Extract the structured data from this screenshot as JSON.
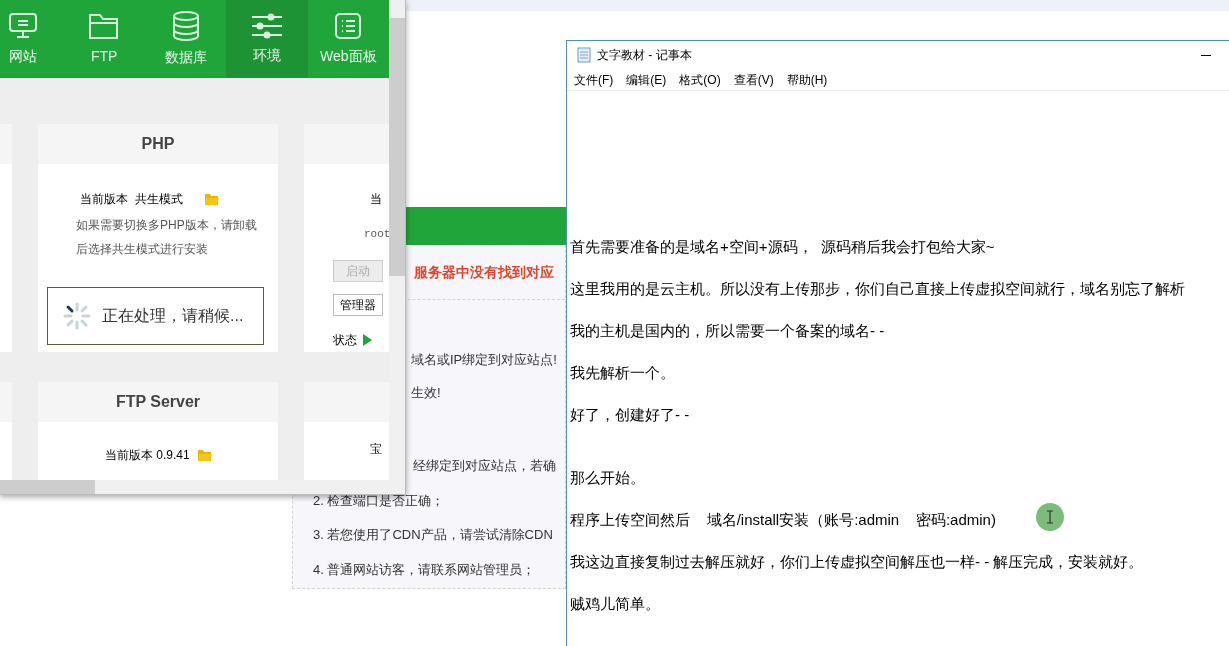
{
  "panel": {
    "nav": [
      {
        "label": "网站",
        "selected": false
      },
      {
        "label": "FTP",
        "selected": false
      },
      {
        "label": "数据库",
        "selected": false
      },
      {
        "label": "环境",
        "selected": true
      },
      {
        "label": "Web面板",
        "selected": false
      }
    ],
    "php_card": {
      "title": "PHP",
      "version": "当前版本  共生模式",
      "note_lines": [
        "如果需要切换多PHP版本，请卸载",
        "后选择共生模式进行安装"
      ]
    },
    "loading": {
      "text": "正在处理，请稍候..."
    },
    "side_card": {
      "line_1": "当",
      "line_2": "root",
      "start_button": {
        "label": "启动",
        "disabled": true
      },
      "manager_button": {
        "label": "管理器",
        "disabled": false
      },
      "status_label": "状态"
    },
    "ftp_card": {
      "title": "FTP Server",
      "version": "当前版本 0.9.41"
    },
    "side_card_2": {
      "line_1": "宝"
    }
  },
  "background_page": {
    "error_title": "服务器中没有找到对应",
    "lines": [
      "域名或IP绑定到对应站点!",
      "生效!"
    ],
    "steps": [
      "经绑定到对应站点，若确",
      "2. 检查端口是否正确；",
      "3. 若您使用了CDN产品，请尝试清除CDN",
      "4. 普通网站访客，请联系网站管理员；"
    ]
  },
  "notepad": {
    "title": "文字教材 - 记事本",
    "menu": [
      "文件(F)",
      "编辑(E)",
      "格式(O)",
      "查看(V)",
      "帮助(H)"
    ],
    "sections": [
      {
        "lines": [
          "首先需要准备的是域名+空间+源码，  源码稍后我会打包给大家~",
          "这里我用的是云主机。所以没有上传那步，你们自己直接上传虚拟空间就行，域名别忘了解析",
          "我的主机是国内的，所以需要一个备案的域名- -",
          "我先解析一个。",
          "好了，创建好了- -"
        ]
      },
      {
        "lines": [
          "那么开始。",
          "程序上传空间然后    域名/install安装（账号:admin    密码:admin)",
          "我这边直接复制过去解压就好，你们上传虚拟空间解压也一样- - 解压完成，安装就好。",
          "贼鸡儿简单。"
        ]
      }
    ]
  }
}
